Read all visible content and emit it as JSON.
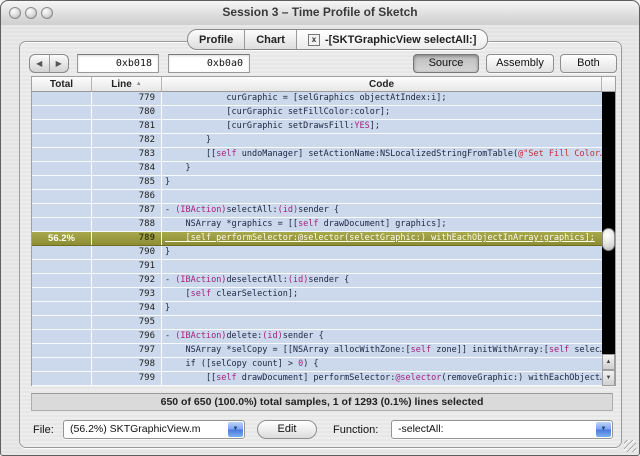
{
  "window": {
    "title": "Session 3 – Time Profile of Sketch"
  },
  "tabs": [
    {
      "label": "Profile"
    },
    {
      "label": "Chart"
    },
    {
      "label": "-[SKTGraphicView selectAll:]",
      "close_icon": "x"
    }
  ],
  "toolbar": {
    "back_icon": "◀",
    "forward_icon": "▶",
    "address_field_1": "0xb018",
    "address_field_2": "0xb0a0",
    "source_label": "Source",
    "assembly_label": "Assembly",
    "both_label": "Both"
  },
  "table": {
    "columns": {
      "total": "Total",
      "line": "Line",
      "code": "Code"
    },
    "sort_icon": "▲",
    "rows": [
      {
        "line": "779",
        "total": "",
        "segs": [
          [
            "p",
            "            curGraphic = [selGraphics objectAtIndex:i];"
          ]
        ]
      },
      {
        "line": "780",
        "total": "",
        "segs": [
          [
            "p",
            "            [curGraphic setFillColor:color];"
          ]
        ]
      },
      {
        "line": "781",
        "total": "",
        "segs": [
          [
            "p",
            "            [curGraphic setDrawsFill:"
          ],
          [
            "k",
            "YES"
          ],
          [
            "p",
            "];"
          ]
        ]
      },
      {
        "line": "782",
        "total": "",
        "segs": [
          [
            "p",
            "        }"
          ]
        ]
      },
      {
        "line": "783",
        "total": "",
        "segs": [
          [
            "p",
            "        [["
          ],
          [
            "k",
            "self"
          ],
          [
            "p",
            " undoManager] setActionName:NSLocalizedStringFromTable("
          ],
          [
            "s",
            "@\"Set Fill Color…"
          ]
        ]
      },
      {
        "line": "784",
        "total": "",
        "segs": [
          [
            "p",
            "    }"
          ]
        ]
      },
      {
        "line": "785",
        "total": "",
        "segs": [
          [
            "p",
            "}"
          ]
        ]
      },
      {
        "line": "786",
        "total": "",
        "segs": []
      },
      {
        "line": "787",
        "total": "",
        "segs": [
          [
            "p",
            "- "
          ],
          [
            "k",
            "(IBAction)"
          ],
          [
            "p",
            "selectAll:"
          ],
          [
            "k",
            "(id)"
          ],
          [
            "p",
            "sender {"
          ]
        ]
      },
      {
        "line": "788",
        "total": "",
        "segs": [
          [
            "p",
            "    NSArray *graphics = [["
          ],
          [
            "k",
            "self"
          ],
          [
            "p",
            " drawDocument] graphics];"
          ]
        ]
      },
      {
        "line": "789",
        "total": "56.2%",
        "hl": true,
        "segs": [
          [
            "p",
            "    [self performSelector:@selector(selectGraphic:) withEachObjectInArray:graphics];"
          ]
        ]
      },
      {
        "line": "790",
        "total": "",
        "segs": [
          [
            "p",
            "}"
          ]
        ]
      },
      {
        "line": "791",
        "total": "",
        "segs": []
      },
      {
        "line": "792",
        "total": "",
        "segs": [
          [
            "p",
            "- "
          ],
          [
            "k",
            "(IBAction)"
          ],
          [
            "p",
            "deselectAll:"
          ],
          [
            "k",
            "(id)"
          ],
          [
            "p",
            "sender {"
          ]
        ]
      },
      {
        "line": "793",
        "total": "",
        "segs": [
          [
            "p",
            "    ["
          ],
          [
            "k",
            "self"
          ],
          [
            "p",
            " clearSelection];"
          ]
        ]
      },
      {
        "line": "794",
        "total": "",
        "segs": [
          [
            "p",
            "}"
          ]
        ]
      },
      {
        "line": "795",
        "total": "",
        "segs": []
      },
      {
        "line": "796",
        "total": "",
        "segs": [
          [
            "p",
            "- "
          ],
          [
            "k",
            "(IBAction)"
          ],
          [
            "p",
            "delete:"
          ],
          [
            "k",
            "(id)"
          ],
          [
            "p",
            "sender {"
          ]
        ]
      },
      {
        "line": "797",
        "total": "",
        "segs": [
          [
            "p",
            "    NSArray *selCopy = [[NSArray allocWithZone:["
          ],
          [
            "k",
            "self"
          ],
          [
            "p",
            " zone]] initWithArray:["
          ],
          [
            "k",
            "self"
          ],
          [
            "p",
            " selec…"
          ]
        ]
      },
      {
        "line": "798",
        "total": "",
        "segs": [
          [
            "p",
            "    if ([selCopy count] > "
          ],
          [
            "k",
            "0"
          ],
          [
            "p",
            ") {"
          ]
        ]
      },
      {
        "line": "799",
        "total": "",
        "segs": [
          [
            "p",
            "        [["
          ],
          [
            "k",
            "self"
          ],
          [
            "p",
            " drawDocument] performSelector:"
          ],
          [
            "k",
            "@selector"
          ],
          [
            "p",
            "(removeGraphic:) withEachObject…"
          ]
        ]
      }
    ]
  },
  "scrollbar": {
    "up_icon": "▲",
    "down_icon": "▼"
  },
  "status_bar": {
    "text": "650 of 650 (100.0%) total samples, 1 of 1293 (0.1%) lines selected"
  },
  "footer": {
    "file_label": "File:",
    "file_value": "(56.2%) SKTGraphicView.m",
    "edit_label": "Edit",
    "function_label": "Function:",
    "function_value": "-selectAll:",
    "dropdown_icon": "▼"
  },
  "colors": {
    "row_bg": "#ccd9ec",
    "highlight_top": "#a8a84c",
    "highlight_bottom": "#8c8c34",
    "keyword": "#a4217c",
    "string": "#c03030",
    "accent_blue": "#4a7ada",
    "track_black": "#000000"
  }
}
